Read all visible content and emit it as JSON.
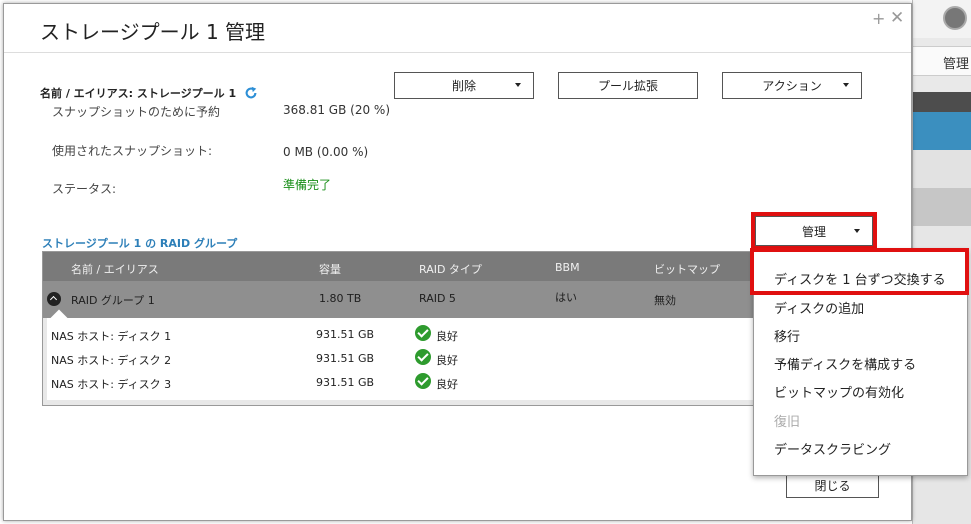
{
  "background_app": {
    "tab_label": "管理"
  },
  "dialog": {
    "title": "ストレージプール 1 管理",
    "alias_line": "名前 / エイリアス: ストレージプール 1",
    "buttons": {
      "delete": "削除",
      "expand": "プール拡張",
      "action": "アクション"
    },
    "info": [
      {
        "label": "スナップショットのために予約",
        "value": "368.81 GB (20 %)"
      },
      {
        "label": "使用されたスナップショット:",
        "value": "0 MB (0.00 %)"
      },
      {
        "label": "ステータス:",
        "value": "準備完了"
      }
    ],
    "section_title": "ストレージプール 1 の RAID グループ",
    "manage_button": "管理",
    "table": {
      "headers": [
        "名前 / エイリアス",
        "容量",
        "RAID タイプ",
        "BBM",
        "ビットマップ"
      ],
      "group": {
        "name": "RAID グループ 1",
        "capacity": "1.80 TB",
        "raid": "RAID 5",
        "bbm": "はい",
        "bitmap": "無効"
      },
      "disks": [
        {
          "name": "NAS ホスト: ディスク 1",
          "capacity": "931.51 GB",
          "status": "良好"
        },
        {
          "name": "NAS ホスト: ディスク 2",
          "capacity": "931.51 GB",
          "status": "良好"
        },
        {
          "name": "NAS ホスト: ディスク 3",
          "capacity": "931.51 GB",
          "status": "良好"
        }
      ]
    },
    "menu": [
      "ディスクを 1 台ずつ交換する",
      "ディスクの追加",
      "移行",
      "予備ディスクを構成する",
      "ビットマップの有効化",
      "復旧",
      "データスクラビング"
    ],
    "close_button": "閉じる"
  },
  "colors": {
    "highlight": "#e01010",
    "accent": "#2d7fb8",
    "ok": "#1a8f1a"
  }
}
